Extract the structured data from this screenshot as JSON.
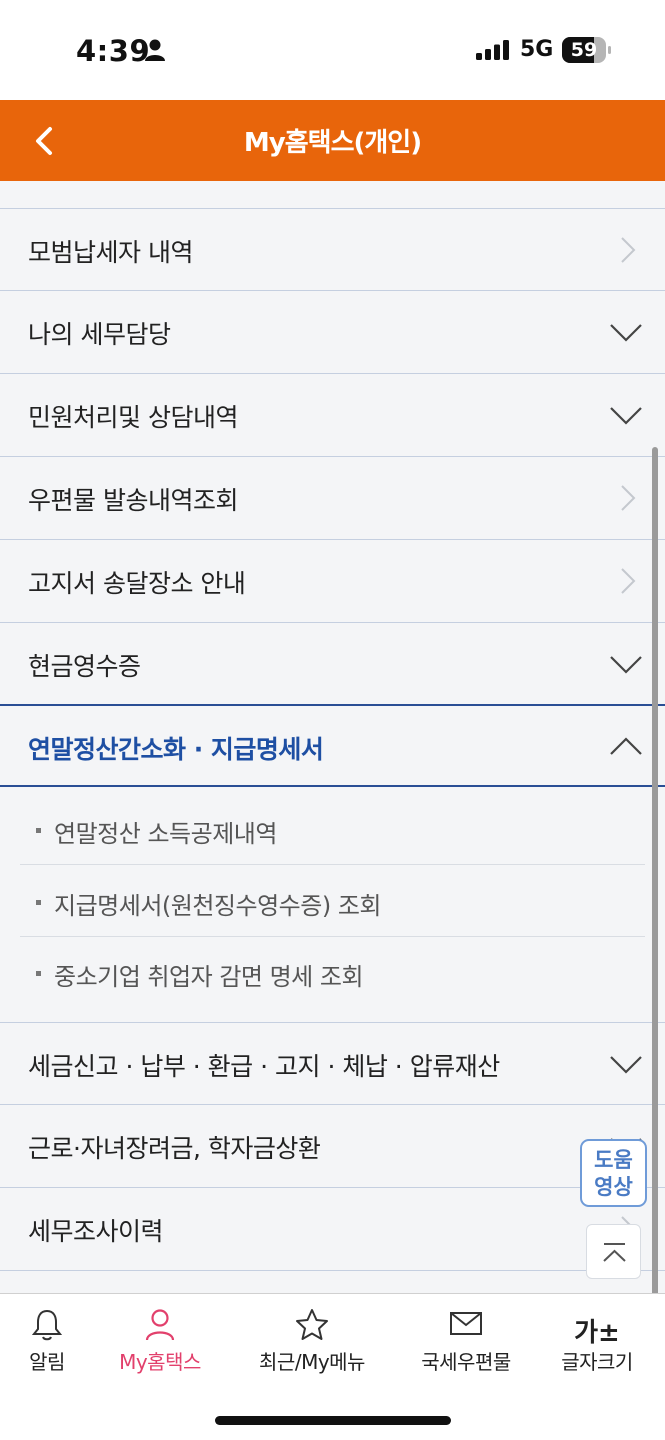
{
  "status_bar": {
    "time": "4:39",
    "network": "5G",
    "battery_level": "59",
    "icons": [
      "person-icon",
      "signal-icon",
      "battery-icon"
    ]
  },
  "header": {
    "title": "My홈택스(개인)",
    "back_icon": "chevron-left-icon",
    "background_color": "#e8650b"
  },
  "menu": {
    "items": [
      {
        "label": "모범납세자 내역",
        "icon": "chevron-right-icon"
      },
      {
        "label": "나의 세무담당",
        "icon": "chevron-down-icon"
      },
      {
        "label": "민원처리및 상담내역",
        "icon": "chevron-down-icon"
      },
      {
        "label": "우편물 발송내역조회",
        "icon": "chevron-right-icon"
      },
      {
        "label": "고지서 송달장소 안내",
        "icon": "chevron-right-icon"
      },
      {
        "label": "현금영수증",
        "icon": "chevron-down-icon"
      },
      {
        "label": "연말정산간소화 · 지급명세서",
        "icon": "chevron-up-icon",
        "expanded": true
      },
      {
        "label": "세금신고 · 납부 · 환급 · 고지 · 체납 · 압류재산",
        "icon": "chevron-down-icon"
      },
      {
        "label": "근로·자녀장려금, 학자금상환",
        "icon": "chevron-down-icon"
      },
      {
        "label": "세무조사이력",
        "icon": "chevron-right-icon"
      }
    ],
    "submenu": [
      {
        "label": "연말정산 소득공제내역"
      },
      {
        "label": "지급명세서(원천징수영수증) 조회"
      },
      {
        "label": "중소기업 취업자 감면 명세 조회"
      }
    ],
    "active_color": "#1e4fa3"
  },
  "floating": {
    "help_video_label": "도움\n영상",
    "scroll_top_icon": "scroll-top-icon"
  },
  "bottom_nav": {
    "items": [
      {
        "label": "알림",
        "icon": "bell-icon"
      },
      {
        "label": "My홈택스",
        "icon": "user-icon",
        "active": true
      },
      {
        "label": "최근/My메뉴",
        "icon": "star-icon"
      },
      {
        "label": "국세우편물",
        "icon": "envelope-icon"
      },
      {
        "label": "글자크기",
        "icon": "font-size-icon",
        "glyph": "가±"
      }
    ],
    "active_color": "#e2406c"
  }
}
